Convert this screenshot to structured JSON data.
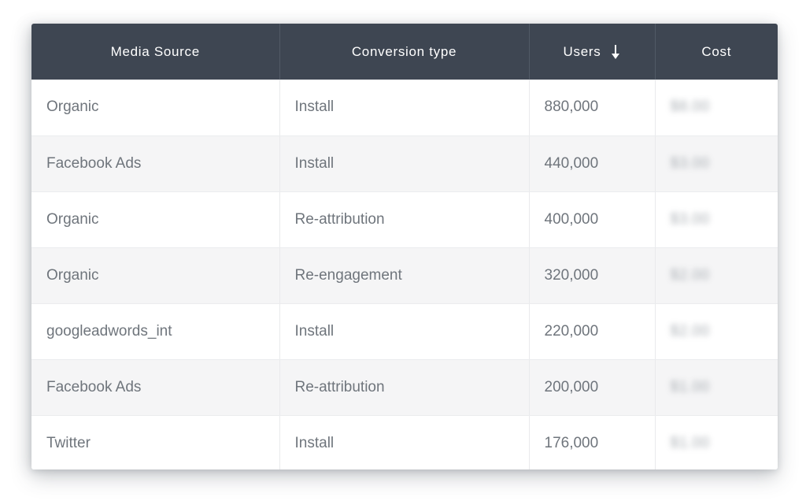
{
  "card": {
    "background": "#ffffff",
    "header_background": "#3e4652",
    "header_text_color": "#ffffff",
    "body_text_color": "#6f757c",
    "row_alt_background": "#f5f5f6",
    "border_color": "#e9eaec"
  },
  "table": {
    "columns": [
      {
        "key": "media_source",
        "label": "Media Source",
        "align": "left",
        "sorted": false
      },
      {
        "key": "conversion_type",
        "label": "Conversion type",
        "align": "left",
        "sorted": false
      },
      {
        "key": "users",
        "label": "Users",
        "align": "left",
        "sorted": true,
        "sort_direction": "descending",
        "sort_icon": "arrow-down-icon"
      },
      {
        "key": "cost",
        "label": "Cost",
        "align": "left",
        "sorted": false
      }
    ],
    "rows": [
      {
        "media_source": "Organic",
        "conversion_type": "Install",
        "users": "880,000",
        "cost": "$8.00",
        "cost_redacted": true
      },
      {
        "media_source": "Facebook Ads",
        "conversion_type": "Install",
        "users": "440,000",
        "cost": "$3.00",
        "cost_redacted": true
      },
      {
        "media_source": "Organic",
        "conversion_type": "Re-attribution",
        "users": "400,000",
        "cost": "$3.00",
        "cost_redacted": true
      },
      {
        "media_source": "Organic",
        "conversion_type": "Re-engagement",
        "users": "320,000",
        "cost": "$2.00",
        "cost_redacted": true
      },
      {
        "media_source": "googleadwords_int",
        "conversion_type": "Install",
        "users": "220,000",
        "cost": "$2.00",
        "cost_redacted": true
      },
      {
        "media_source": "Facebook Ads",
        "conversion_type": "Re-attribution",
        "users": "200,000",
        "cost": "$1.00",
        "cost_redacted": true
      },
      {
        "media_source": "Twitter",
        "conversion_type": "Install",
        "users": "176,000",
        "cost": "$1.00",
        "cost_redacted": true
      }
    ]
  }
}
